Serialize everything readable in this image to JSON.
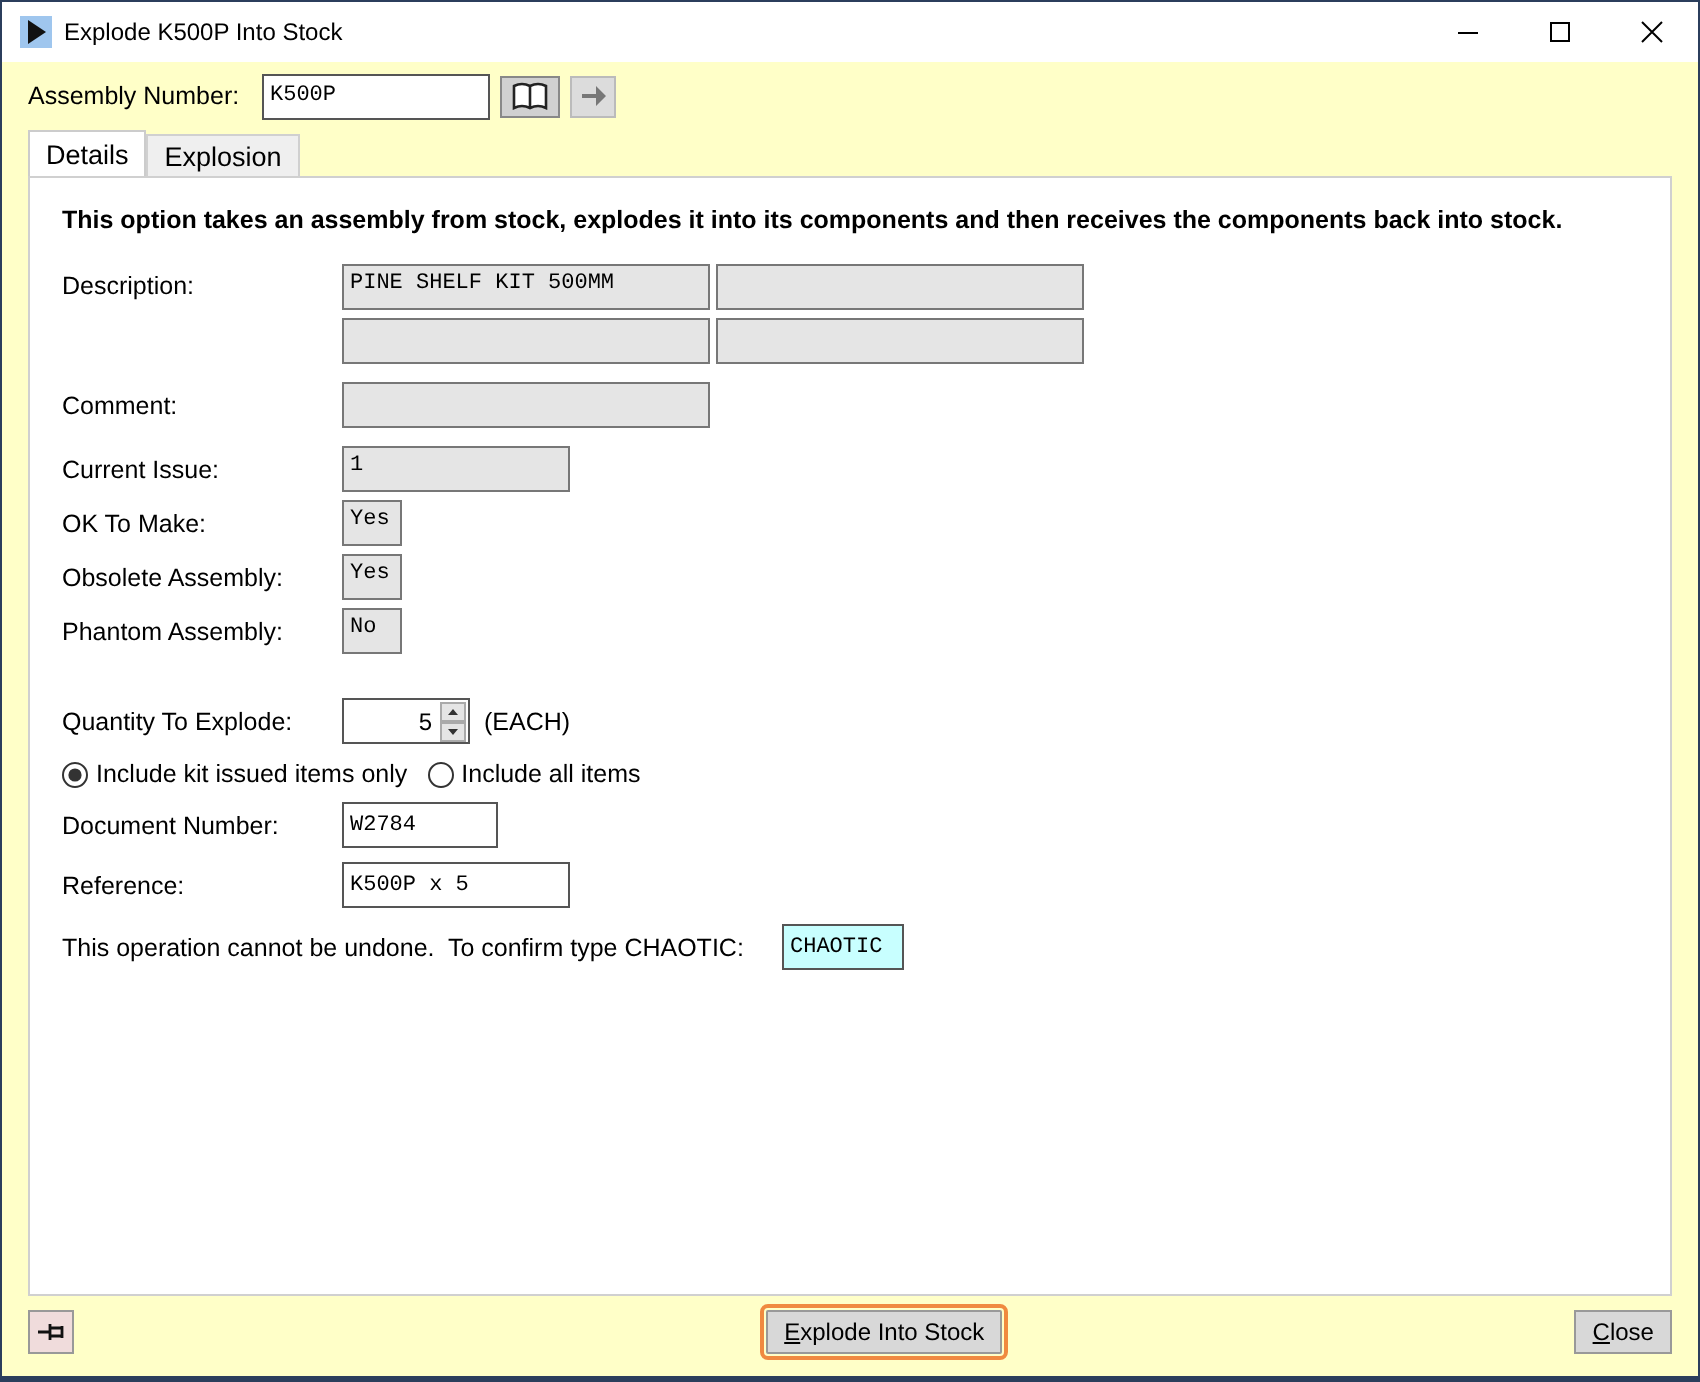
{
  "window": {
    "title": "Explode K500P Into Stock"
  },
  "assembly": {
    "label": "Assembly Number:",
    "value": "K500P"
  },
  "tabs": [
    {
      "label": "Details",
      "selected": true
    },
    {
      "label": "Explosion",
      "selected": false
    }
  ],
  "intro": "This option takes an assembly from stock, explodes it into its components and then receives the components back into stock.",
  "info_fields": [
    {
      "kind": "description",
      "label": "Description:",
      "value": "PINE SHELF KIT 500MM"
    },
    {
      "kind": "wide",
      "label": "Comment:"
    },
    {
      "kind": "medium",
      "label": "Current Issue:",
      "value": "1"
    },
    {
      "kind": "short",
      "label": "OK To Make:",
      "value": "Yes"
    },
    {
      "kind": "short",
      "label": "Obsolete Assembly:",
      "value": "Yes"
    },
    {
      "kind": "short",
      "label": "Phantom Assembly:",
      "value": "No"
    }
  ],
  "quantity": {
    "label": "Quantity To Explode:",
    "value": "5",
    "unit": "(EACH)"
  },
  "include_options": [
    {
      "label": "Include kit issued items only",
      "selected": true
    },
    {
      "label": "Include all items",
      "selected": false
    }
  ],
  "document_number": {
    "label": "Document Number:",
    "value": "W2784"
  },
  "reference": {
    "label": "Reference:",
    "value": "K500P x 5"
  },
  "confirm": {
    "label": "This operation cannot be undone.  To confirm type CHAOTIC:",
    "value": "CHAOTIC"
  },
  "buttons": {
    "primary": "Explode Into Stock",
    "close": "Close"
  }
}
